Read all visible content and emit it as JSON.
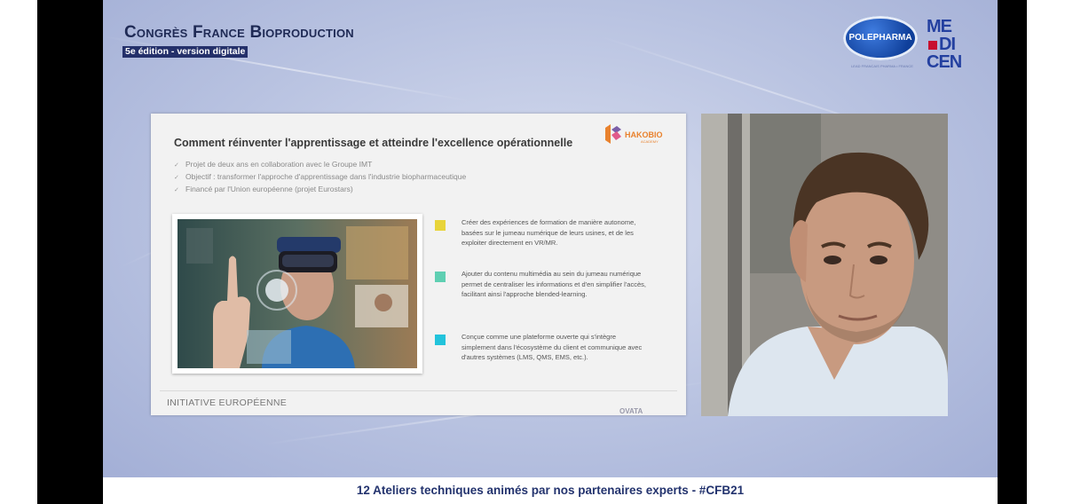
{
  "event": {
    "title": "Congrès France Bioproduction",
    "subtitle": "5e édition - version digitale"
  },
  "logos": {
    "polepharma": "POLEPHARMA",
    "polepharma_tag": "LEAD FRANCAIS PHARMA • FRANCE",
    "medicen": [
      "ME",
      "DI",
      "CEN"
    ],
    "hakobio": "HAKOBIO",
    "hakobio_sub": "ACADEMY",
    "slide_corner": "OVATA"
  },
  "slide": {
    "title": "Comment réinventer l'apprentissage et atteindre l'excellence opérationnelle",
    "bullets": [
      "Projet de deux ans en collaboration avec le Groupe IMT",
      "Objectif : transformer l'approche d'apprentissage dans l'industrie biopharmaceutique",
      "Financé par l'Union européenne (projet Eurostars)"
    ],
    "features": [
      {
        "color": "#e8d43a",
        "text": "Créer des expériences de formation de manière autonome, basées sur le jumeau numérique de leurs usines, et de les exploiter directement en VR/MR."
      },
      {
        "color": "#5fcfb2",
        "text": "Ajouter du contenu multimédia au sein du jumeau numérique permet de centraliser les informations et d'en simplifier l'accès, facilitant ainsi l'approche blended-learning."
      },
      {
        "color": "#22c3db",
        "text": "Conçue comme une plateforme ouverte qui s'intègre simplement dans l'écosystème du client et communique avec d'autres systèmes (LMS, QMS, EMS, etc.)."
      }
    ],
    "footer": "INITIATIVE EUROPÉENNE"
  },
  "banner": {
    "text": "12 Ateliers techniques animés par nos partenaires experts - #CFB21"
  },
  "colors": {
    "navy": "#23336e",
    "background": "#b9c3e1",
    "hako_orange": "#e9822e"
  }
}
